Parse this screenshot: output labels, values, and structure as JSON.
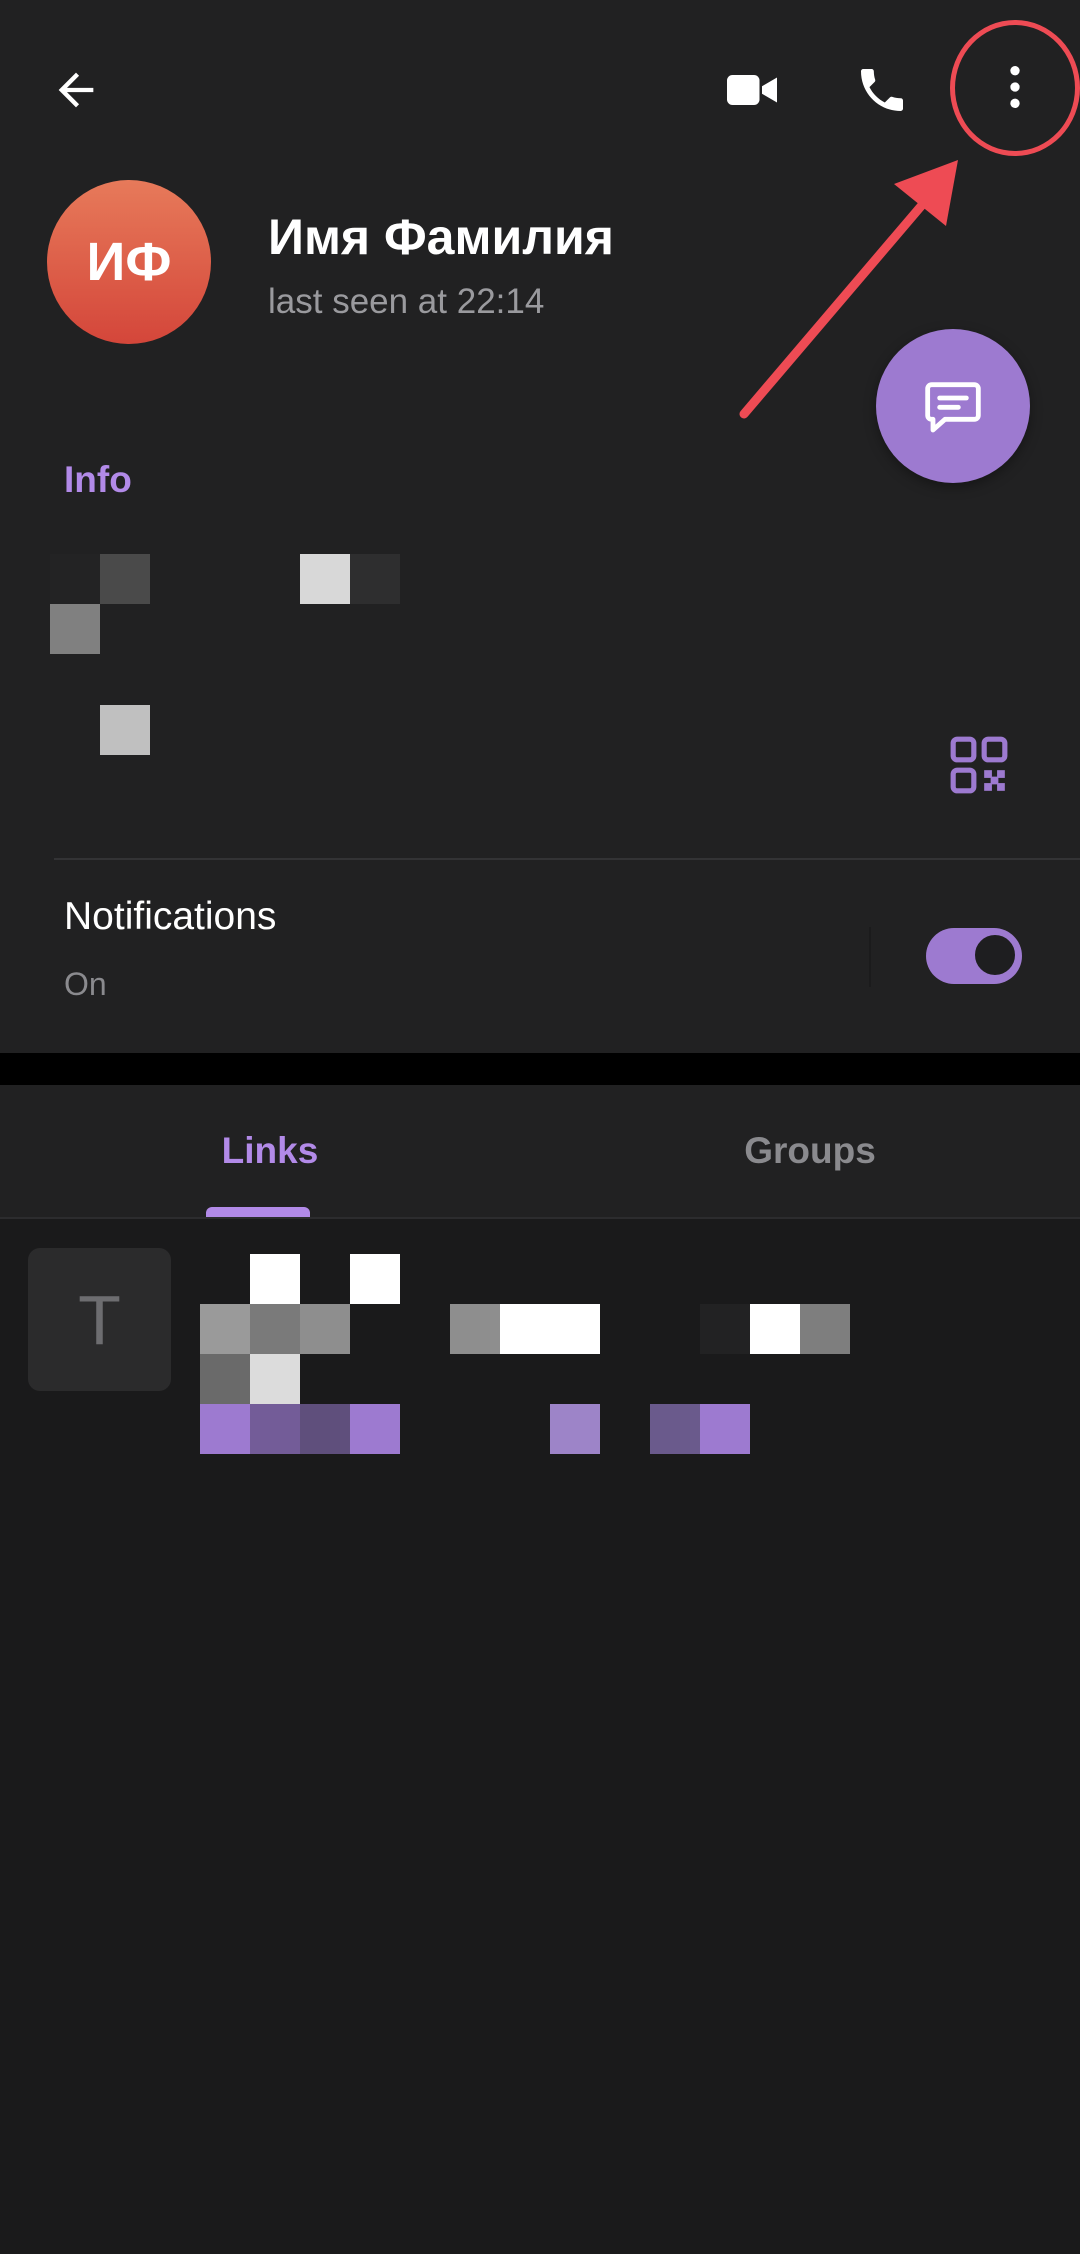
{
  "header": {
    "back_icon": "arrow-left-icon",
    "video_icon": "video-camera-icon",
    "call_icon": "phone-icon",
    "more_icon": "more-vert-icon"
  },
  "profile": {
    "initials": "ИФ",
    "name": "Имя Фамилия",
    "status": "last seen at 22:14",
    "avatar_colors": [
      "#e77a5a",
      "#d4463a"
    ]
  },
  "fab": {
    "icon": "message-icon",
    "color": "#9d7ad0"
  },
  "info": {
    "title": "Info",
    "qr_icon": "qr-code-icon"
  },
  "notifications": {
    "title": "Notifications",
    "value": "On",
    "enabled": true
  },
  "tabs": {
    "items": [
      {
        "label": "Links",
        "active": true
      },
      {
        "label": "Groups",
        "active": false
      }
    ]
  },
  "links": [
    {
      "thumb_letter": "T"
    }
  ],
  "annotation": {
    "color": "#ee4b54"
  },
  "colors": {
    "accent": "#b28ae8",
    "accent_fill": "#9d7ad0",
    "background": "#1a1a1b",
    "surface": "#212122"
  }
}
